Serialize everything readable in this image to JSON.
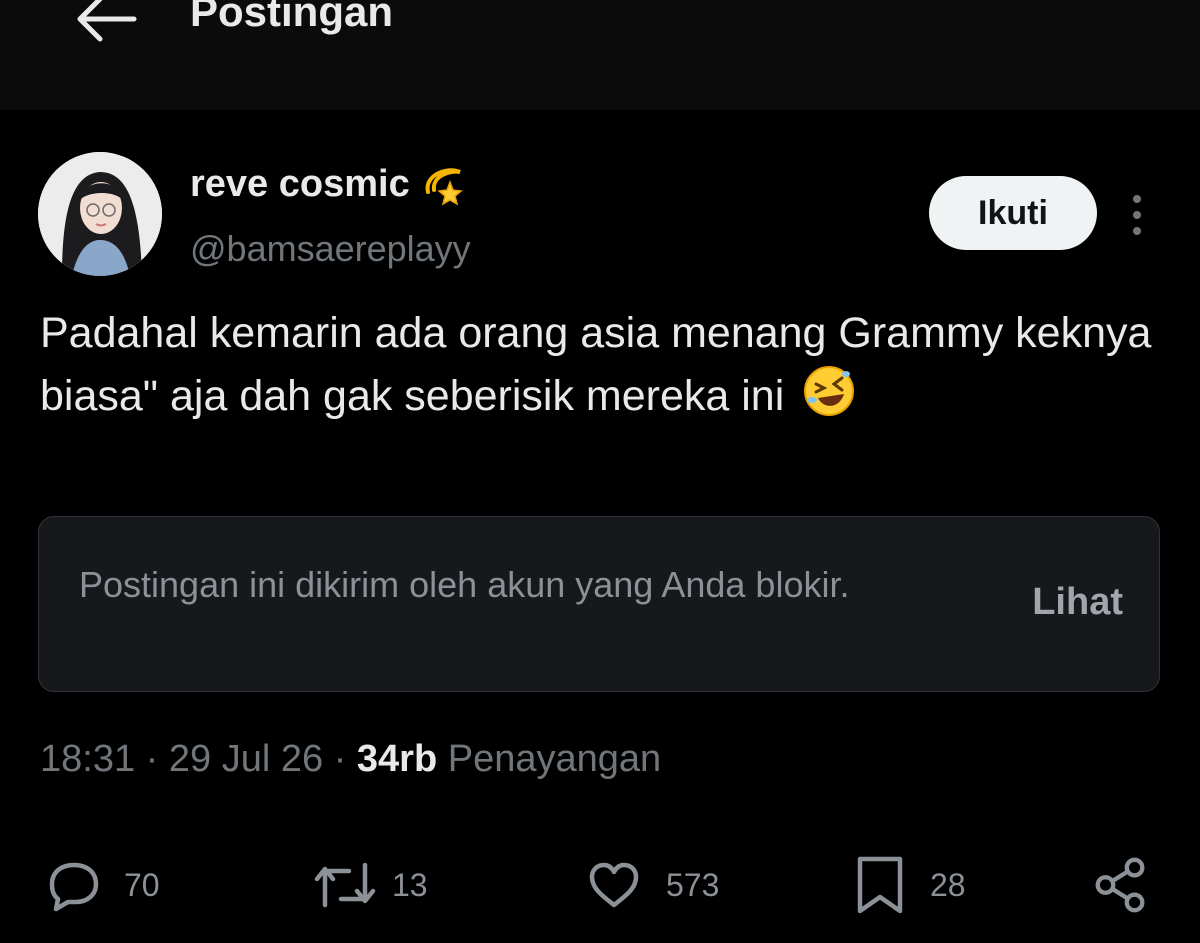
{
  "header": {
    "title": "Postingan",
    "back_icon": "arrow-left-icon"
  },
  "author": {
    "display_name": "reve cosmic",
    "name_emoji": "dizzy-star-emoji",
    "handle": "@bamsaereplayy",
    "follow_label": "Ikuti",
    "more_icon": "more-vertical-icon"
  },
  "post": {
    "text": "Padahal kemarin ada orang asia menang Grammy keknya biasa\" aja dah gak seberisik mereka ini",
    "trailing_emoji": "rolling-on-floor-laughing-emoji"
  },
  "notice": {
    "text": "Postingan ini dikirim oleh akun yang Anda blokir.",
    "action_label": "Lihat"
  },
  "meta": {
    "time": "18:31",
    "separator": "·",
    "date": "29 Jul 26",
    "views_count": "34rb",
    "views_label": "Penayangan"
  },
  "actions": {
    "replies": "70",
    "reposts": "13",
    "likes": "573",
    "bookmarks": "28"
  },
  "colors": {
    "background": "#000000",
    "text": "#e7e9ea",
    "muted": "#71767b",
    "follow_bg": "#eff3f4"
  }
}
